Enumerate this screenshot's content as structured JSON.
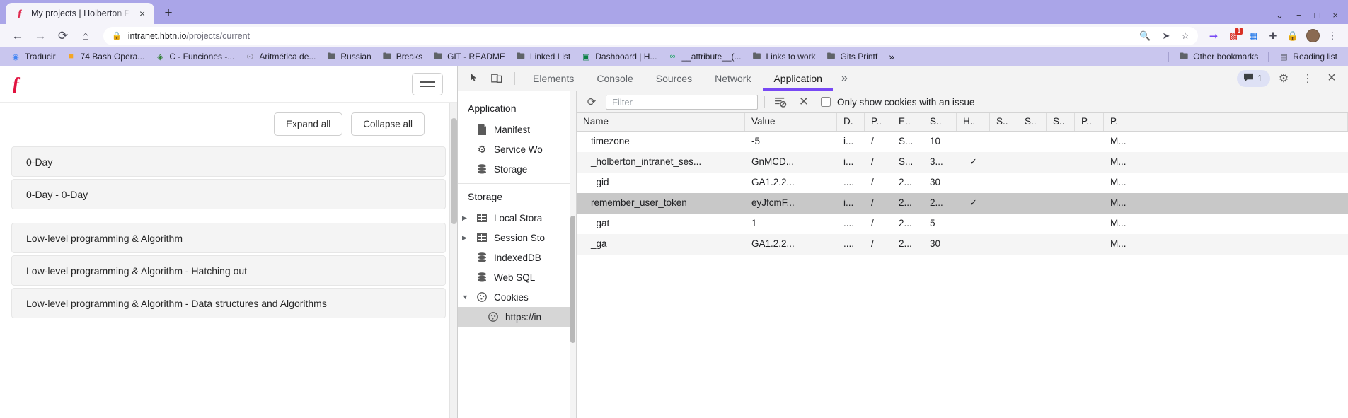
{
  "browser": {
    "tab": {
      "title": "My projects | Holberton P",
      "favicon": "holberton-favicon",
      "close": "×"
    },
    "new_tab": "+",
    "window_controls": {
      "minimize": "−",
      "maximize": "□",
      "close": "×",
      "caret": "⌄"
    },
    "nav": {
      "back": "←",
      "forward": "→",
      "reload": "⟳",
      "home": "⌂"
    },
    "omnibox": {
      "lock": "🔒",
      "host": "intranet.hbtn.io",
      "path": "/projects/current",
      "zoom_icon": "🔍",
      "share_icon": "➤",
      "star_icon": "☆"
    },
    "extensions": [
      {
        "name": "translate-extension-icon",
        "glyph": "➡",
        "badge": ""
      },
      {
        "name": "notification-extension-icon",
        "glyph": "◩",
        "badge": "1"
      },
      {
        "name": "grid-extension-icon",
        "glyph": "▦",
        "badge": ""
      },
      {
        "name": "puzzle-extensions-icon",
        "glyph": "🧩",
        "badge": ""
      },
      {
        "name": "lock-extension-icon",
        "glyph": "🔒",
        "badge": ""
      }
    ],
    "profile_avatar": "avatar",
    "menu_dots": "⋮",
    "bookmarks": [
      {
        "label": "Traducir",
        "icon": "google-translate-icon"
      },
      {
        "label": "74 Bash Opera...",
        "icon": "site-icon"
      },
      {
        "label": "C - Funciones -...",
        "icon": "site-icon"
      },
      {
        "label": "Aritmética de...",
        "icon": "site-icon"
      },
      {
        "label": "Russian",
        "icon": "folder-icon"
      },
      {
        "label": "Breaks",
        "icon": "folder-icon"
      },
      {
        "label": "GIT - README",
        "icon": "folder-icon"
      },
      {
        "label": "Linked List",
        "icon": "folder-icon"
      },
      {
        "label": "Dashboard | H...",
        "icon": "site-icon"
      },
      {
        "label": "__attribute__(...",
        "icon": "site-icon"
      },
      {
        "label": "Links to work",
        "icon": "folder-icon"
      },
      {
        "label": "Gits Printf",
        "icon": "folder-icon"
      }
    ],
    "bookmarks_overflow": "»",
    "other_bookmarks": {
      "label": "Other bookmarks",
      "icon": "folder-icon"
    },
    "reading_list": {
      "label": "Reading list",
      "icon": "reading-list-icon"
    }
  },
  "page": {
    "logo": "ƒ",
    "menu_toggle": "hamburger-menu",
    "expand_all": "Expand all",
    "collapse_all": "Collapse all",
    "projects": [
      {
        "label": "0-Day",
        "group": 1
      },
      {
        "label": "0-Day - 0-Day",
        "group": 1
      },
      {
        "label": "Low-level programming & Algorithm",
        "group": 2
      },
      {
        "label": "Low-level programming & Algorithm - Hatching out",
        "group": 2
      },
      {
        "label": "Low-level programming & Algorithm - Data structures and Algorithms",
        "group": 2
      }
    ]
  },
  "devtools": {
    "inspect_icon": "inspect-element-icon",
    "device_icon": "device-toolbar-icon",
    "tabs": [
      {
        "label": "Elements",
        "active": false
      },
      {
        "label": "Console",
        "active": false
      },
      {
        "label": "Sources",
        "active": false
      },
      {
        "label": "Network",
        "active": false
      },
      {
        "label": "Application",
        "active": true
      }
    ],
    "more_tabs": "»",
    "messages_count": "1",
    "messages_icon": "message-bubble-icon",
    "settings_icon": "gear-icon",
    "kebab_icon": "⋮",
    "close_icon": "×",
    "accent_color": "#7748f4",
    "sidebar": {
      "application_title": "Application",
      "application_items": [
        {
          "label": "Manifest",
          "icon": "manifest-icon"
        },
        {
          "label": "Service Wo",
          "icon": "gear-icon"
        },
        {
          "label": "Storage",
          "icon": "database-icon"
        }
      ],
      "storage_title": "Storage",
      "storage_items": [
        {
          "label": "Local Stora",
          "icon": "table-icon",
          "twisty": "▶",
          "indent": false
        },
        {
          "label": "Session Sto",
          "icon": "table-icon",
          "twisty": "▶",
          "indent": false
        },
        {
          "label": "IndexedDB",
          "icon": "database-icon",
          "twisty": "",
          "indent": false
        },
        {
          "label": "Web SQL",
          "icon": "database-icon",
          "twisty": "",
          "indent": false
        },
        {
          "label": "Cookies",
          "icon": "cookie-icon",
          "twisty": "▼",
          "indent": false
        },
        {
          "label": "https://in",
          "icon": "cookie-icon",
          "twisty": "",
          "indent": true,
          "selected": true
        }
      ]
    },
    "cookie_toolbar": {
      "refresh_icon": "refresh-icon",
      "filter_placeholder": "Filter",
      "filter_value": "",
      "clear_filters_icon": "clear-filters-icon",
      "clear_all_icon": "✕",
      "issue_checkbox_label": "Only show cookies with an issue",
      "issue_checkbox_checked": false
    },
    "cookie_table": {
      "columns": [
        "Name",
        "Value",
        "D.",
        "P..",
        "E..",
        "S..",
        "H..",
        "S..",
        "S..",
        "S..",
        "P..",
        "P."
      ],
      "rows": [
        {
          "name": "timezone",
          "value": "-5",
          "d": "i...",
          "p": "/",
          "e": "S...",
          "s1": "10",
          "h": "",
          "s2": "",
          "s3": "",
          "s4": "",
          "p2": "",
          "p3": "M...",
          "selected": false
        },
        {
          "name": "_holberton_intranet_ses...",
          "value": "GnMCD...",
          "d": "i...",
          "p": "/",
          "e": "S...",
          "s1": "3...",
          "h": "✓",
          "s2": "",
          "s3": "",
          "s4": "",
          "p2": "",
          "p3": "M...",
          "selected": false
        },
        {
          "name": "_gid",
          "value": "GA1.2.2...",
          "d": "....",
          "p": "/",
          "e": "2...",
          "s1": "30",
          "h": "",
          "s2": "",
          "s3": "",
          "s4": "",
          "p2": "",
          "p3": "M...",
          "selected": false
        },
        {
          "name": "remember_user_token",
          "value": "eyJfcmF...",
          "d": "i...",
          "p": "/",
          "e": "2...",
          "s1": "2...",
          "h": "✓",
          "s2": "",
          "s3": "",
          "s4": "",
          "p2": "",
          "p3": "M...",
          "selected": true
        },
        {
          "name": "_gat",
          "value": "1",
          "d": "....",
          "p": "/",
          "e": "2...",
          "s1": "5",
          "h": "",
          "s2": "",
          "s3": "",
          "s4": "",
          "p2": "",
          "p3": "M...",
          "selected": false
        },
        {
          "name": "_ga",
          "value": "GA1.2.2...",
          "d": "....",
          "p": "/",
          "e": "2...",
          "s1": "30",
          "h": "",
          "s2": "",
          "s3": "",
          "s4": "",
          "p2": "",
          "p3": "M...",
          "selected": false
        }
      ]
    }
  }
}
